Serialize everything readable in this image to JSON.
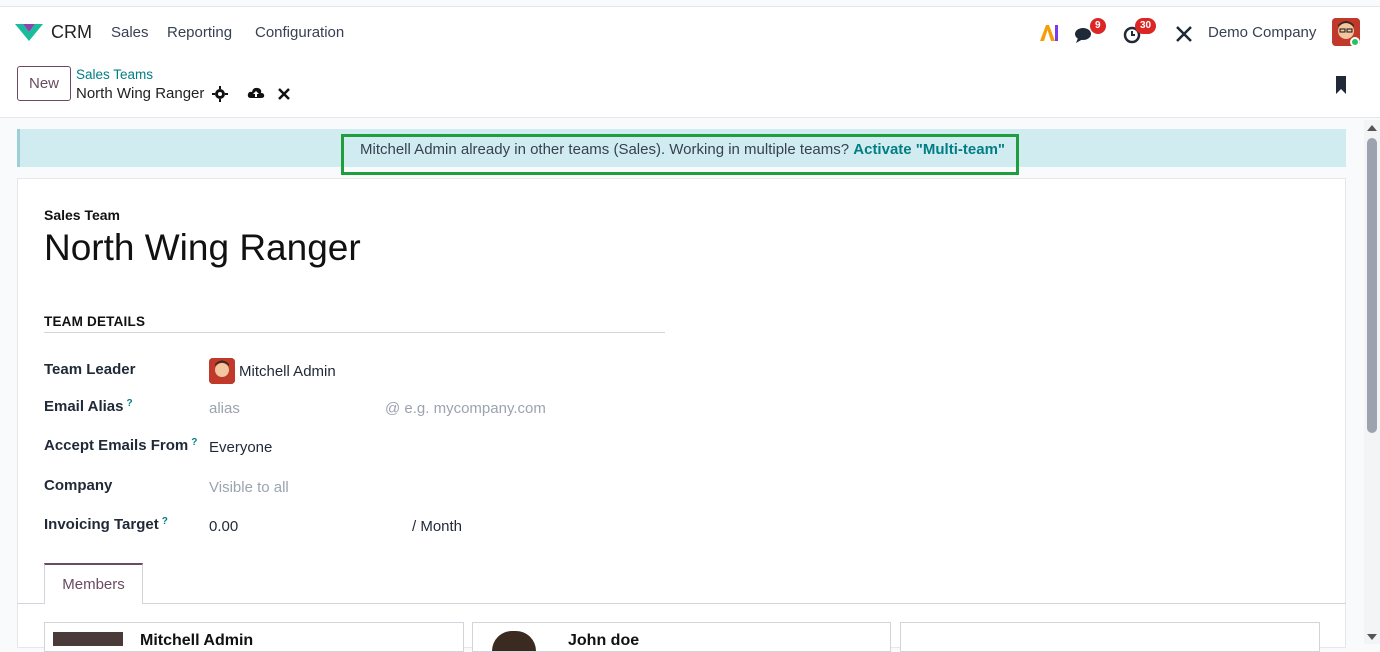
{
  "topbar": {
    "app_name": "CRM",
    "menu": [
      "Sales",
      "Reporting",
      "Configuration"
    ],
    "messages_count": "9",
    "activities_count": "30",
    "company": "Demo Company"
  },
  "control": {
    "new_label": "New",
    "breadcrumb_parent": "Sales Teams",
    "breadcrumb_current": "North Wing Ranger"
  },
  "alert": {
    "text": "Mitchell Admin already in other teams (Sales). Working in multiple teams? ",
    "link": "Activate \"Multi-team\""
  },
  "form": {
    "record_type": "Sales Team",
    "title": "North Wing Ranger",
    "section": "TEAM DETAILS",
    "fields": {
      "team_leader": {
        "label": "Team Leader",
        "value": "Mitchell Admin"
      },
      "email_alias": {
        "label": "Email Alias",
        "help": "?",
        "placeholder": "alias",
        "domain": "@ e.g. mycompany.com"
      },
      "accept_emails": {
        "label": "Accept Emails From",
        "help": "?",
        "value": "Everyone"
      },
      "company": {
        "label": "Company",
        "placeholder": "Visible to all"
      },
      "invoicing_target": {
        "label": "Invoicing Target",
        "help": "?",
        "value": "0.00",
        "unit": "/ Month"
      }
    },
    "tabs": [
      "Members"
    ],
    "members": [
      "Mitchell Admin",
      "John doe"
    ]
  },
  "icons": {
    "logo": "crm-logo-icon",
    "ai": "ai-icon",
    "messages": "chat-icon",
    "activities": "clock-icon",
    "tools": "tools-icon",
    "gear": "gear-icon",
    "save": "cloud-upload-icon",
    "discard": "close-icon",
    "bookmark": "bookmark-icon"
  },
  "colors": {
    "accent": "#6b4a62",
    "link": "#017e84",
    "alert_bg": "#d1ecf1",
    "highlight": "#1e9e3e",
    "badge": "#dc2626"
  }
}
